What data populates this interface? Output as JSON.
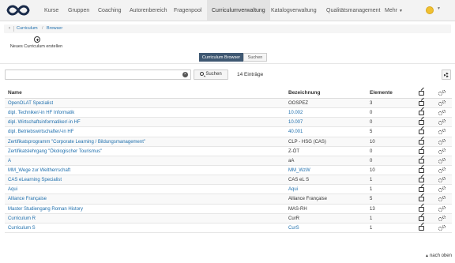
{
  "nav": {
    "items": [
      {
        "label": "Kurse"
      },
      {
        "label": "Gruppen"
      },
      {
        "label": "Coaching"
      },
      {
        "label": "Autorenbereich"
      },
      {
        "label": "Fragenpool"
      },
      {
        "label": "Curriculumverwaltung"
      },
      {
        "label": "Katalogverwaltung"
      },
      {
        "label": "Qualitätsmanagement"
      },
      {
        "label": "Mehr"
      }
    ],
    "active": "Curriculumverwaltung"
  },
  "breadcrumb": {
    "items": [
      "Curriculum",
      "Browser"
    ]
  },
  "toolbar": {
    "new_label": "Neues Curriculum erstellen"
  },
  "segments": {
    "browser": "Curriculum Browser",
    "search": "Suchen"
  },
  "search": {
    "value": "",
    "button": "Suchen",
    "count": "14 Einträge"
  },
  "table": {
    "headers": {
      "name": "Name",
      "bezeichnung": "Bezeichnung",
      "elemente": "Elemente"
    },
    "rows": [
      {
        "name": "OpenOLAT Spezialist",
        "bez": "OOSPEZ",
        "el": "3",
        "bez_link": false
      },
      {
        "name": "dipl. Techniker/-in HF Informatik",
        "bez": "10.002",
        "el": "0",
        "bez_link": true
      },
      {
        "name": "dipl. Wirtschaftsinformatiker/-in HF",
        "bez": "10.007",
        "el": "0",
        "bez_link": true
      },
      {
        "name": "dipl. Betriebswirtschafter/-in HF",
        "bez": "40.001",
        "el": "5",
        "bez_link": true
      },
      {
        "name": "Zertifikatsprogramm \"Corporate Learning / Bildungsmanagement\"",
        "bez": "CLP - HSG (CAS)",
        "el": "10",
        "bez_link": false
      },
      {
        "name": "Zertifikatslehrgang \"Ökologischer Tourismus\"",
        "bez": "Z-ÖT",
        "el": "0",
        "bez_link": false
      },
      {
        "name": "A",
        "bez": "aA",
        "el": "0",
        "bez_link": false
      },
      {
        "name": "MM_Wege zur Weltherrschaft",
        "bez": "MM_WzW",
        "el": "10",
        "bez_link": true
      },
      {
        "name": "CAS eLearning Specialist",
        "bez": "CAS eL S",
        "el": "1",
        "bez_link": false
      },
      {
        "name": "Aqui",
        "bez": "Aqui",
        "el": "1",
        "bez_link": true
      },
      {
        "name": "Alliance Française",
        "bez": "Alliance Française",
        "el": "5",
        "bez_link": false
      },
      {
        "name": "Master Studiengang Roman History",
        "bez": "MAS-RH",
        "el": "13",
        "bez_link": false
      },
      {
        "name": "Curriculum R",
        "bez": "CurR",
        "el": "1",
        "bez_link": false
      },
      {
        "name": "Curriculum S",
        "bez": "CurS",
        "el": "1",
        "bez_link": true
      }
    ]
  },
  "footer": {
    "top_link": "nach oben"
  },
  "colors": {
    "link": "#1f6fad",
    "active_segment": "#3f5872",
    "nav_bg": "#f3f3f3",
    "user_avatar": "#f0c030"
  }
}
